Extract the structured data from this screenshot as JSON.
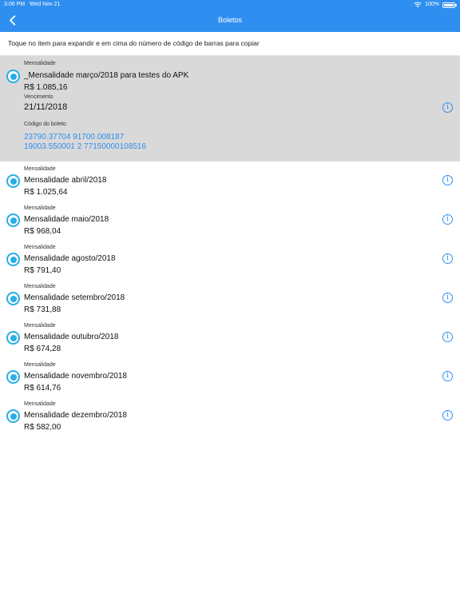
{
  "status_bar": {
    "time": "3:06 PM",
    "date": "Wed Nov 21",
    "battery": "100%"
  },
  "nav": {
    "title": "Boletos"
  },
  "instructions": "Toque no item para expandir e em cima do número de código de barras para copiar",
  "expanded_item": {
    "category": "Mensalidade",
    "title": "_Mensalidade março/2018 para testes do APK",
    "amount": "R$ 1.085,16",
    "due_label": "Vencimento",
    "due_date": "21/11/2018",
    "barcode_label": "Código do boleto",
    "barcode_line1": "23790.37704 91700.008187",
    "barcode_line2": "19003.550001 2 77150000108516"
  },
  "items": [
    {
      "category": "Mensalidade",
      "title": "Mensalidade abril/2018",
      "amount": "R$ 1.025,64"
    },
    {
      "category": "Mensalidade",
      "title": "Mensalidade maio/2018",
      "amount": "R$ 968,04"
    },
    {
      "category": "Mensalidade",
      "title": "Mensalidade agosto/2018",
      "amount": "R$ 791,40"
    },
    {
      "category": "Mensalidade",
      "title": "Mensalidade setembro/2018",
      "amount": "R$ 731,88"
    },
    {
      "category": "Mensalidade",
      "title": "Mensalidade outubro/2018",
      "amount": "R$ 674,28"
    },
    {
      "category": "Mensalidade",
      "title": "Mensalidade novembro/2018",
      "amount": "R$ 614,76"
    },
    {
      "category": "Mensalidade",
      "title": "Mensalidade dezembro/2018",
      "amount": "R$ 582,00"
    }
  ],
  "colors": {
    "nav_bar": "#2f8ff0",
    "radio": "#29aee6",
    "barcode": "#2f8ff0",
    "expanded_bg": "#d9d9d9"
  },
  "icons": {
    "back": "chevron-left-icon",
    "info": "info-circle-icon",
    "wifi": "wifi-icon",
    "battery": "battery-icon"
  }
}
